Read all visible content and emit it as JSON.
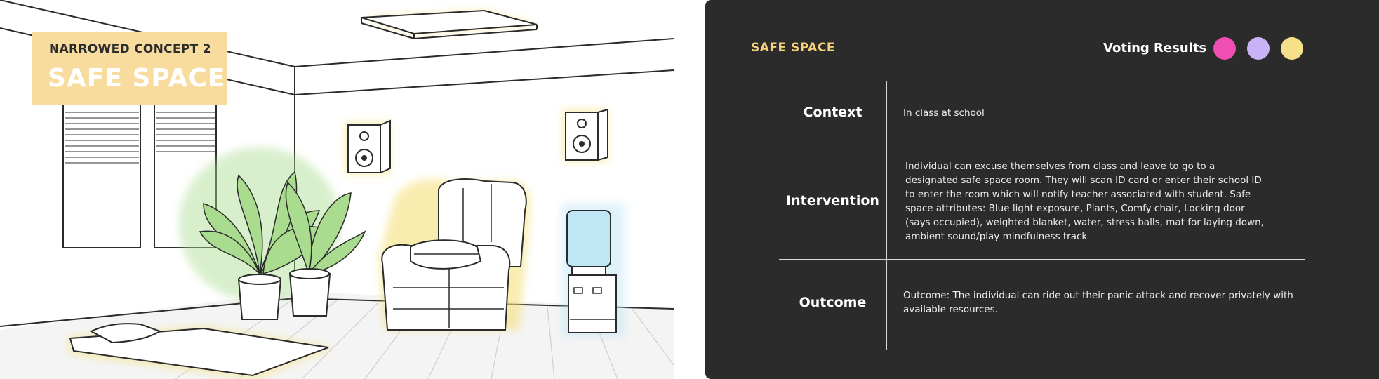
{
  "illustration": {
    "eyebrow": "NARROWED CONCEPT 2",
    "title": "SAFE SPACE",
    "card_color": "#f7dc9e",
    "glow_color": "#f5e07a",
    "plant_color": "#a9dc8f",
    "water_color": "#bfe6f5",
    "icons": [
      "window-blinds-icon",
      "ceiling-light-icon",
      "speaker-icon",
      "plant-icon",
      "recliner-chair-icon",
      "blanket-icon",
      "water-cooler-icon",
      "mat-icon"
    ]
  },
  "panel": {
    "title": "SAFE SPACE",
    "voting_label": "Voting Results",
    "votes": [
      {
        "color": "#f04eb0"
      },
      {
        "color": "#c9b3f6"
      },
      {
        "color": "#f8e08a"
      }
    ],
    "rows": [
      {
        "label": "Context",
        "text": "In class at school"
      },
      {
        "label": "Intervention",
        "text": "Individual can excuse themselves from class and leave to go to a designated safe space room. They will scan ID card or enter their school ID to enter the room which will notify teacher associated with student. Safe space attributes: Blue light exposure, Plants, Comfy chair, Locking door (says occupied), weighted blanket, water, stress balls, mat for laying down, ambient sound/play mindfulness track"
      },
      {
        "label": "Outcome",
        "text": "Outcome: The individual can ride out their panic attack and recover privately with available resources."
      }
    ]
  }
}
